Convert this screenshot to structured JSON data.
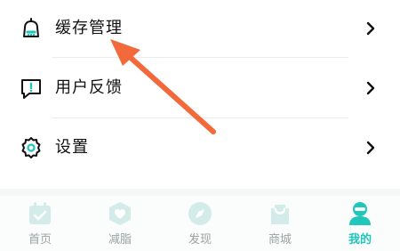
{
  "menu": {
    "items": [
      {
        "label": "缓存管理",
        "icon": "bell-broom-icon"
      },
      {
        "label": "用户反馈",
        "icon": "feedback-icon"
      },
      {
        "label": "设置",
        "icon": "gear-icon"
      }
    ]
  },
  "tabbar": {
    "tabs": [
      {
        "label": "首页",
        "icon": "calendar-icon"
      },
      {
        "label": "减脂",
        "icon": "shield-heart-icon"
      },
      {
        "label": "发现",
        "icon": "compass-icon"
      },
      {
        "label": "商城",
        "icon": "shopping-bag-icon"
      },
      {
        "label": "我的",
        "icon": "user-icon",
        "active": true
      }
    ]
  },
  "colors": {
    "accent": "#1fc7bb",
    "annotation_arrow": "#f26a3b",
    "inactive": "#c9e9e6"
  }
}
